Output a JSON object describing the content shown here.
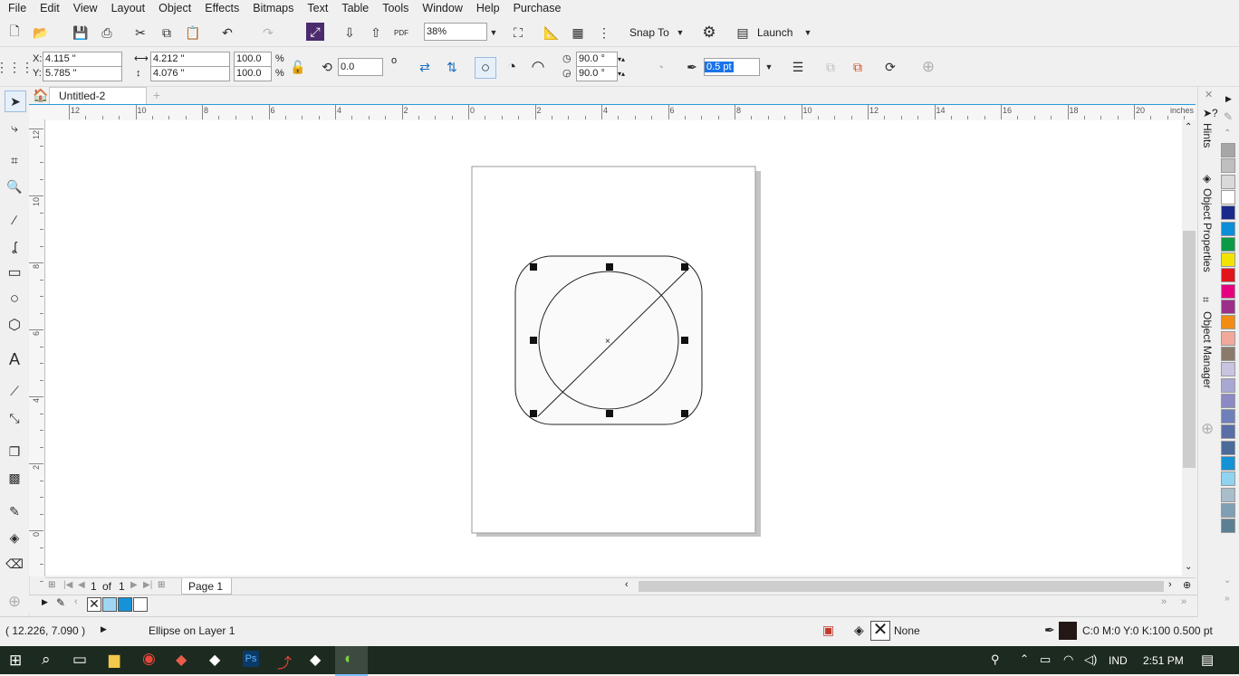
{
  "menu": [
    "File",
    "Edit",
    "View",
    "Layout",
    "Object",
    "Effects",
    "Bitmaps",
    "Text",
    "Table",
    "Tools",
    "Window",
    "Help",
    "Purchase"
  ],
  "standard_toolbar": {
    "zoom": "38%",
    "snap_to": "Snap To",
    "launch": "Launch",
    "pdf": "PDF"
  },
  "property_bar": {
    "x_label": "X:",
    "x": "4.115 \"",
    "y_label": "Y:",
    "y": "5.785 \"",
    "width": "4.212 \"",
    "height": "4.076 \"",
    "scale_w": "100.0",
    "scale_h": "100.0",
    "percent": "%",
    "rotation": "0.0",
    "degree": "o",
    "angle_start": "90.0 °",
    "angle_end": "90.0 °",
    "outline": "0.5 pt"
  },
  "tab": {
    "title": "Untitled-2"
  },
  "ruler": {
    "unit": "inches",
    "h_labels": [
      "12",
      "10",
      "8",
      "6",
      "4",
      "2",
      "0",
      "2",
      "4",
      "6",
      "8",
      "10",
      "12",
      "14",
      "16",
      "18",
      "20"
    ],
    "v_labels": [
      "12",
      "10",
      "8",
      "6",
      "4",
      "2",
      "0"
    ]
  },
  "page_nav": {
    "current": "1",
    "of": "of",
    "total": "1",
    "page_tab": "Page 1"
  },
  "status": {
    "coords": "( 12.226, 7.090 )",
    "object": "Ellipse on Layer 1",
    "fill": "None",
    "outline": "C:0 M:0 Y:0 K:100  0.500 pt"
  },
  "docker_tabs": [
    "Hints",
    "Object Properties",
    "Object Manager"
  ],
  "palette_colors": [
    "#a6a6a6",
    "#bfbfbf",
    "#d9d9d9",
    "#ffffff",
    "#1a2a8c",
    "#0a8fd8",
    "#0c9a46",
    "#f2e400",
    "#e2141b",
    "#e4007e",
    "#9b2f8a",
    "#f28c14",
    "#f3a89c",
    "#8b7a6b",
    "#c7c4e0",
    "#a9a7d3",
    "#8c89c4",
    "#6f7fb9",
    "#5a6fa8",
    "#4b6a9a",
    "#1591d5",
    "#8fd3f0",
    "#a9bdcb",
    "#7f9fb5",
    "#5c7f94"
  ],
  "doc_palette": [
    "#9fd6f5",
    "#1592d8",
    "#ffffff"
  ],
  "taskbar": {
    "time": "2:51 PM",
    "lang": "IND"
  }
}
